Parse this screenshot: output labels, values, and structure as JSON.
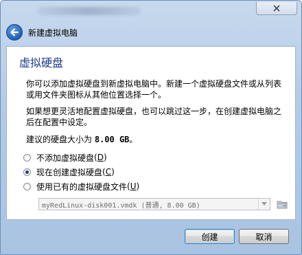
{
  "window": {
    "header_title": "新建虚拟电脑"
  },
  "page": {
    "title": "虚拟硬盘",
    "para1": "你可以添加虚拟硬盘到新虚拟电脑中。新建一个虚拟硬盘文件或从列表或用文件夹图标从其他位置选择一个。",
    "para2": "如果想更灵活地配置虚拟硬盘，也可以跳过这一步，在创建虚拟电脑之后在配置中设定。",
    "size_prefix": "建议的硬盘大小为 ",
    "size_value": "8.00 GB",
    "size_suffix": "。"
  },
  "options": [
    {
      "label": "不添加虚拟硬盘",
      "shortcut": "D",
      "selected": false
    },
    {
      "label": "现在创建虚拟硬盘",
      "shortcut": "C",
      "selected": true
    },
    {
      "label": "使用已有的虚拟硬盘文件",
      "shortcut": "U",
      "selected": false
    }
  ],
  "file_select": {
    "value": "myRedLinux-disk001.vmdk (普通, 8.00 GB)"
  },
  "buttons": {
    "create": "创建",
    "cancel": "取消"
  },
  "icons": {
    "back": "back-arrow-icon",
    "close": "close-icon",
    "folder": "folder-icon"
  },
  "colors": {
    "title_blue": "#1a3c8c",
    "frame": "#b4cbe6"
  }
}
